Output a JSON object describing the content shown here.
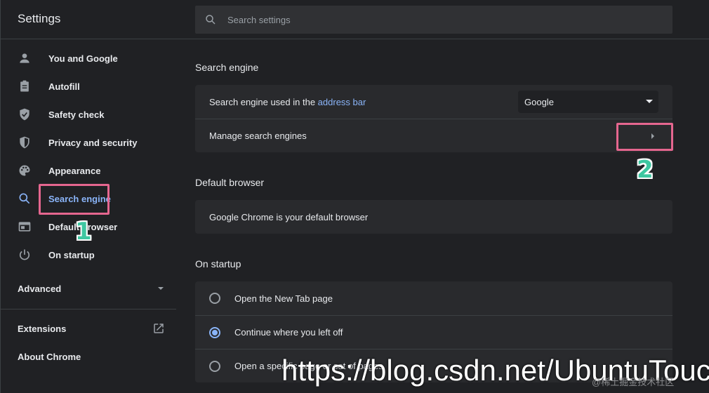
{
  "header": {
    "title": "Settings",
    "search_placeholder": "Search settings"
  },
  "sidebar": {
    "items": [
      {
        "label": "You and Google",
        "icon": "person-icon"
      },
      {
        "label": "Autofill",
        "icon": "clipboard-icon"
      },
      {
        "label": "Safety check",
        "icon": "shield-check-icon"
      },
      {
        "label": "Privacy and security",
        "icon": "shield-icon"
      },
      {
        "label": "Appearance",
        "icon": "palette-icon"
      },
      {
        "label": "Search engine",
        "icon": "search-icon",
        "active": true
      },
      {
        "label": "Default browser",
        "icon": "browser-icon"
      },
      {
        "label": "On startup",
        "icon": "power-icon"
      }
    ],
    "advanced_label": "Advanced",
    "extensions_label": "Extensions",
    "about_label": "About Chrome"
  },
  "main": {
    "search_engine": {
      "title": "Search engine",
      "used_prefix": "Search engine used in the ",
      "used_link": "address bar",
      "selected_engine": "Google",
      "manage_label": "Manage search engines"
    },
    "default_browser": {
      "title": "Default browser",
      "status": "Google Chrome is your default browser"
    },
    "on_startup": {
      "title": "On startup",
      "options": [
        {
          "label": "Open the New Tab page",
          "checked": false
        },
        {
          "label": "Continue where you left off",
          "checked": true
        },
        {
          "label": "Open a specific page or set of pages",
          "checked": false
        }
      ]
    }
  },
  "annotations": {
    "marker_1": "1",
    "marker_2": "2",
    "watermark": "https://blog.csdn.net/UbuntuTouch",
    "watermark_small": "@稀土掘金技术社区"
  },
  "colors": {
    "background": "#202124",
    "card": "#292a2d",
    "accent": "#8ab4f8",
    "annotation_box": "#e5668f",
    "annotation_number": "#3ec7a1"
  }
}
